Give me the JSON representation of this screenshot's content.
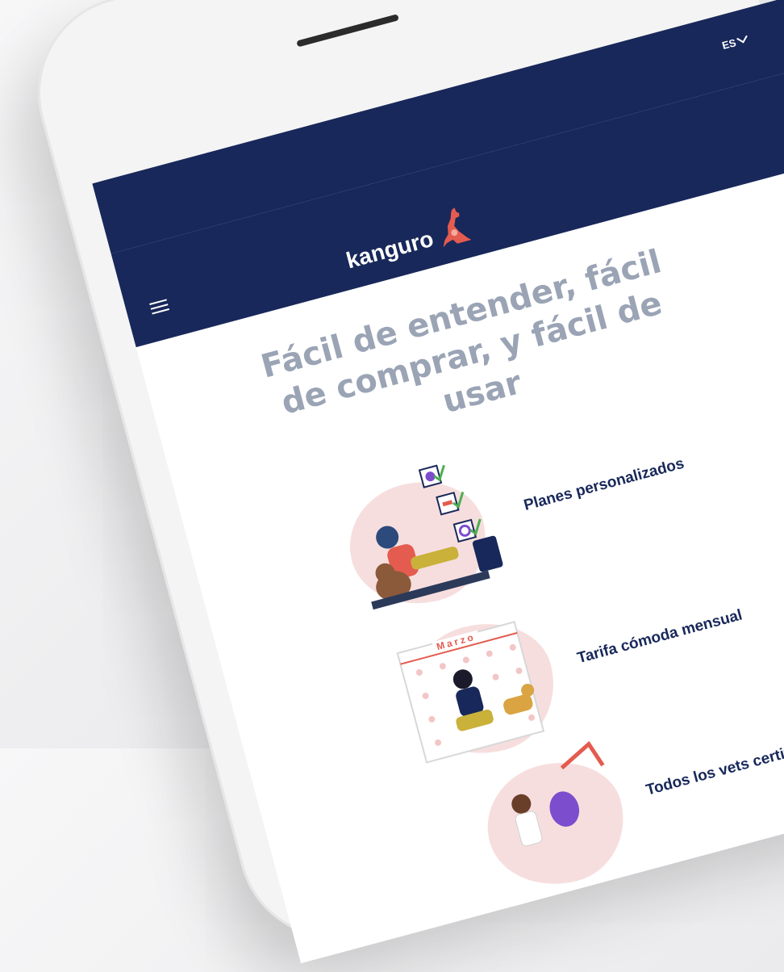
{
  "header": {
    "language": "ES",
    "logo_text": "kanguro"
  },
  "hero": {
    "headline": "Fácil de entender, fácil de comprar, y fácil de usar"
  },
  "features": [
    {
      "label": "Planes personalizados",
      "icon": "checklist-illustration"
    },
    {
      "label": "Tarifa cómoda mensual",
      "icon": "calendar-illustration",
      "calendar_month": "Marzo"
    },
    {
      "label": "Todos los vets certificados",
      "icon": "vet-illustration"
    }
  ],
  "colors": {
    "navbar": "#18285a",
    "headline": "#9aa4b5",
    "accent": "#e45b4f",
    "feature_text": "#18285a",
    "blob": "#f7dede"
  }
}
